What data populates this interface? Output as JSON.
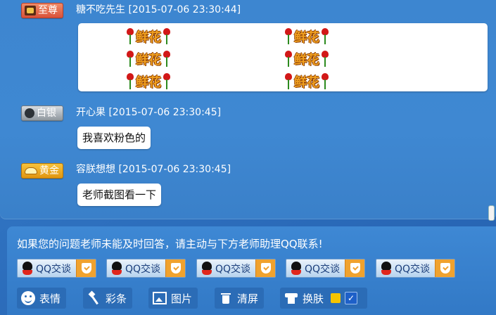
{
  "messages": [
    {
      "badge": "至尊",
      "sender": "糖不吃先生",
      "time": "[2015-07-06 23:30:44]"
    },
    {
      "badge": "白银",
      "sender": "开心果",
      "time": "[2015-07-06 23:30:45]",
      "text": "我喜欢粉色的"
    },
    {
      "badge": "黄金",
      "sender": "容朕想想",
      "time": "[2015-07-06 23:30:45]",
      "text": "老师截图看一下"
    }
  ],
  "flower_label": "鲜花",
  "notice": "如果您的问题老师未能及时回答，请主动与下方老师助理QQ联系!",
  "qq_buttons": [
    "QQ交谈",
    "QQ交谈",
    "QQ交谈",
    "QQ交谈",
    "QQ交谈"
  ],
  "toolbar": {
    "emoji": "表情",
    "caitiao": "彩条",
    "image": "图片",
    "clear": "清屏",
    "skin": "换肤",
    "skin_check": "✓"
  },
  "colors": {
    "flower_text": "#f0a020",
    "rose": "#d21818",
    "skin_swatch": "#f5c400"
  }
}
